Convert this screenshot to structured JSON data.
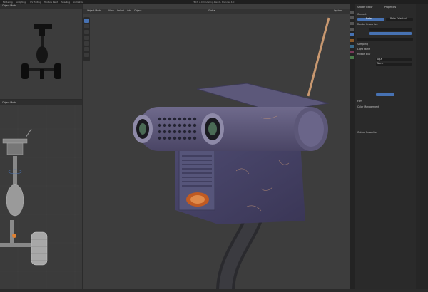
{
  "window": {
    "title": "TECH 2.0 modeling.blend - Blender 4.0"
  },
  "menus": [
    "Modeling",
    "Sculpting",
    "UV Editing",
    "Texture Paint",
    "Shading",
    "Animation"
  ],
  "viewport": {
    "mode": "Object Mode",
    "view_items": [
      "View",
      "Select",
      "Add",
      "Object"
    ],
    "transform": "Global",
    "options": "Options"
  },
  "ref_pane": {
    "mode": "Object Mode"
  },
  "ortho_pane": {
    "mode": "Object Mode"
  },
  "properties": {
    "tabs": [
      "Shader Editor",
      "Properties"
    ],
    "sections": [
      "Context",
      "Render Properties",
      "Sampling",
      "Light Paths",
      "Motion Blur",
      "Film",
      "Color Management",
      "Output Properties"
    ],
    "buttons": [
      "Bake",
      "Bake Selected"
    ],
    "view_transform": "AgX",
    "look": "None"
  },
  "colors": {
    "accent": "#4772b3",
    "viewport_bg": "#3d3d3d",
    "panel_bg": "#2a2a2a"
  }
}
